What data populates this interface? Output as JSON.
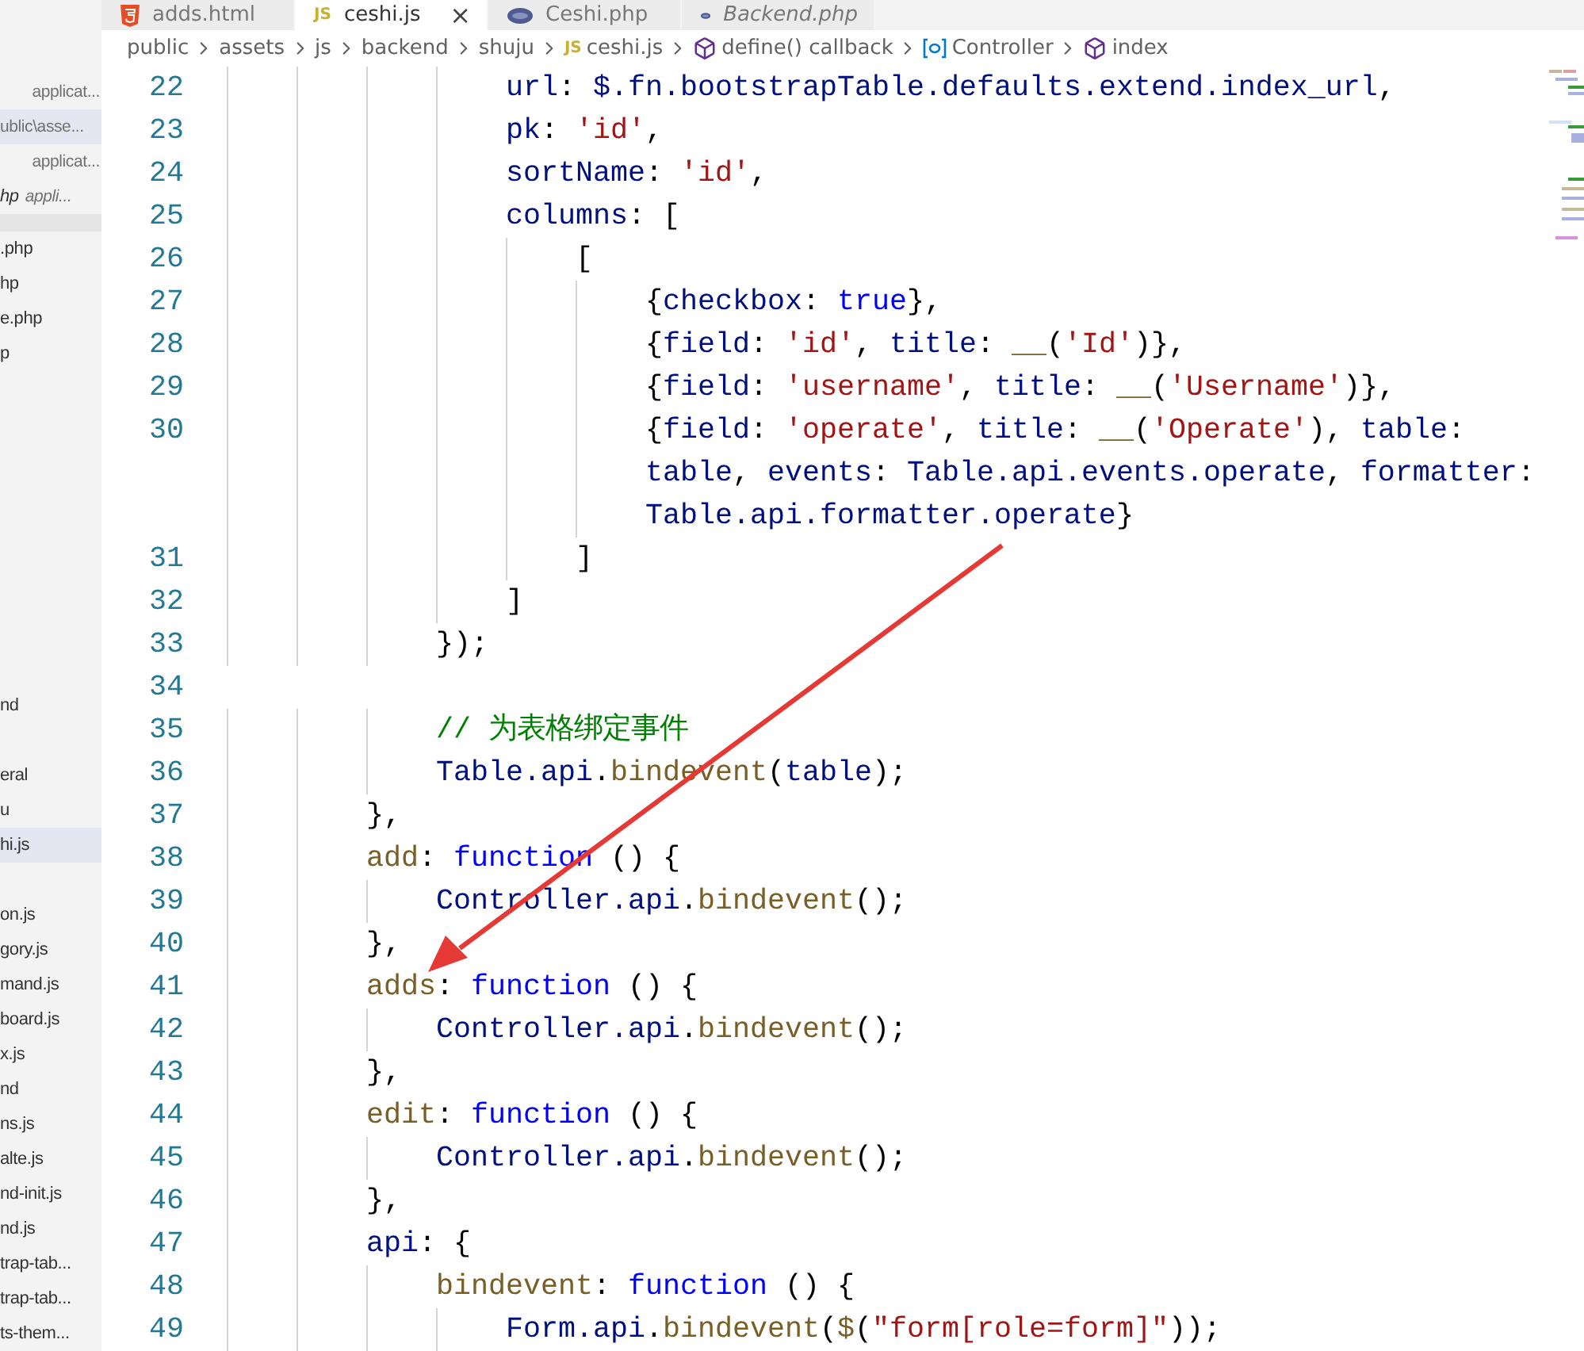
{
  "tabs": [
    {
      "label": "adds.html",
      "kind": "html",
      "selected": false,
      "preview": false
    },
    {
      "label": "ceshi.js",
      "kind": "js",
      "badge": "JS",
      "selected": true,
      "preview": false,
      "close": "×"
    },
    {
      "label": "Ceshi.php",
      "kind": "php",
      "selected": false,
      "preview": false
    },
    {
      "label": "Backend.php",
      "kind": "php",
      "selected": false,
      "preview": true
    }
  ],
  "breadcrumb": [
    {
      "label": "public",
      "kind": "folder"
    },
    {
      "label": "assets",
      "kind": "folder"
    },
    {
      "label": "js",
      "kind": "folder"
    },
    {
      "label": "backend",
      "kind": "folder"
    },
    {
      "label": "shuju",
      "kind": "folder"
    },
    {
      "label": "ceshi.js",
      "kind": "js",
      "badge": "JS"
    },
    {
      "label": "define() callback",
      "kind": "method"
    },
    {
      "label": "Controller",
      "kind": "variable"
    },
    {
      "label": "index",
      "kind": "method"
    }
  ],
  "sidebar": {
    "open_editors": [
      {
        "description": "applicat...",
        "selected": false,
        "preview": false
      },
      {
        "description": "ublic\\asse...",
        "selected": true,
        "preview": false
      },
      {
        "description": "applicat...",
        "selected": false,
        "preview": false
      },
      {
        "name": "hp",
        "description": "appli...",
        "selected": false,
        "preview": true
      }
    ],
    "files_top": [
      {
        "label": ".php",
        "selected": false
      },
      {
        "label": "hp",
        "selected": false
      },
      {
        "label": "e.php",
        "selected": false
      },
      {
        "label": "p",
        "selected": false
      }
    ],
    "file_groups": [
      [
        {
          "label": "nd",
          "selected": false
        }
      ],
      [
        {
          "label": "eral",
          "selected": false
        },
        {
          "label": "u",
          "selected": false
        },
        {
          "label": "hi.js",
          "selected": true
        }
      ],
      [
        {
          "label": "on.js",
          "selected": false
        },
        {
          "label": "gory.js",
          "selected": false
        },
        {
          "label": "mand.js",
          "selected": false
        },
        {
          "label": "board.js",
          "selected": false
        },
        {
          "label": "x.js",
          "selected": false
        },
        {
          "label": "nd",
          "selected": false
        },
        {
          "label": "ns.js",
          "selected": false
        },
        {
          "label": "alte.js",
          "selected": false
        },
        {
          "label": "nd-init.js",
          "selected": false
        },
        {
          "label": "nd.js",
          "selected": false
        },
        {
          "label": "trap-tab...",
          "selected": false
        },
        {
          "label": "trap-tab...",
          "selected": false
        },
        {
          "label": "ts-them...",
          "selected": false
        }
      ]
    ]
  },
  "code": [
    {
      "number": "22",
      "tokens": [
        {
          "kind": "key",
          "text": "                url"
        },
        {
          "kind": "p",
          "text": ": "
        },
        {
          "kind": "var",
          "text": "$.fn.bootstrapTable.defaults.extend.index_url"
        },
        {
          "kind": "p",
          "text": ","
        }
      ]
    },
    {
      "number": "23",
      "tokens": [
        {
          "kind": "key",
          "text": "                pk"
        },
        {
          "kind": "p",
          "text": ": "
        },
        {
          "kind": "str",
          "text": "'id'"
        },
        {
          "kind": "p",
          "text": ","
        }
      ]
    },
    {
      "number": "24",
      "tokens": [
        {
          "kind": "key",
          "text": "                sortName"
        },
        {
          "kind": "p",
          "text": ": "
        },
        {
          "kind": "str",
          "text": "'id'"
        },
        {
          "kind": "p",
          "text": ","
        }
      ]
    },
    {
      "number": "25",
      "tokens": [
        {
          "kind": "key",
          "text": "                columns"
        },
        {
          "kind": "p",
          "text": ": ["
        }
      ]
    },
    {
      "number": "26",
      "tokens": [
        {
          "kind": "p",
          "text": "                    ["
        }
      ]
    },
    {
      "number": "27",
      "tokens": [
        {
          "kind": "p",
          "text": "                        {"
        },
        {
          "kind": "key",
          "text": "checkbox"
        },
        {
          "kind": "p",
          "text": ": "
        },
        {
          "kind": "kw",
          "text": "true"
        },
        {
          "kind": "p",
          "text": "},"
        }
      ]
    },
    {
      "number": "28",
      "tokens": [
        {
          "kind": "p",
          "text": "                        {"
        },
        {
          "kind": "key",
          "text": "field"
        },
        {
          "kind": "p",
          "text": ": "
        },
        {
          "kind": "str",
          "text": "'id'"
        },
        {
          "kind": "p",
          "text": ", "
        },
        {
          "kind": "key",
          "text": "title"
        },
        {
          "kind": "p",
          "text": ": "
        },
        {
          "kind": "fn",
          "text": "__"
        },
        {
          "kind": "p",
          "text": "("
        },
        {
          "kind": "str",
          "text": "'Id'"
        },
        {
          "kind": "p",
          "text": ")},"
        }
      ]
    },
    {
      "number": "29",
      "tokens": [
        {
          "kind": "p",
          "text": "                        {"
        },
        {
          "kind": "key",
          "text": "field"
        },
        {
          "kind": "p",
          "text": ": "
        },
        {
          "kind": "str",
          "text": "'username'"
        },
        {
          "kind": "p",
          "text": ", "
        },
        {
          "kind": "key",
          "text": "title"
        },
        {
          "kind": "p",
          "text": ": "
        },
        {
          "kind": "fn",
          "text": "__"
        },
        {
          "kind": "p",
          "text": "("
        },
        {
          "kind": "str",
          "text": "'Username'"
        },
        {
          "kind": "p",
          "text": ")},"
        }
      ]
    },
    {
      "number": "30",
      "tokens": [
        {
          "kind": "p",
          "text": "                        {"
        },
        {
          "kind": "key",
          "text": "field"
        },
        {
          "kind": "p",
          "text": ": "
        },
        {
          "kind": "str",
          "text": "'operate'"
        },
        {
          "kind": "p",
          "text": ", "
        },
        {
          "kind": "key",
          "text": "title"
        },
        {
          "kind": "p",
          "text": ": "
        },
        {
          "kind": "fn",
          "text": "__"
        },
        {
          "kind": "p",
          "text": "("
        },
        {
          "kind": "str",
          "text": "'Operate'"
        },
        {
          "kind": "p",
          "text": "), "
        },
        {
          "kind": "key",
          "text": "table"
        },
        {
          "kind": "p",
          "text": ":"
        }
      ]
    },
    {
      "tokens": [
        {
          "kind": "var",
          "text": "                        table"
        },
        {
          "kind": "p",
          "text": ", "
        },
        {
          "kind": "key",
          "text": "events"
        },
        {
          "kind": "p",
          "text": ": "
        },
        {
          "kind": "var",
          "text": "Table.api.events.operate"
        },
        {
          "kind": "p",
          "text": ", "
        },
        {
          "kind": "key",
          "text": "formatter"
        },
        {
          "kind": "p",
          "text": ":"
        }
      ]
    },
    {
      "tokens": [
        {
          "kind": "var",
          "text": "                        Table.api.formatter.operate"
        },
        {
          "kind": "p",
          "text": "}"
        }
      ]
    },
    {
      "number": "31",
      "tokens": [
        {
          "kind": "p",
          "text": "                    ]"
        }
      ]
    },
    {
      "number": "32",
      "tokens": [
        {
          "kind": "p",
          "text": "                ]"
        }
      ]
    },
    {
      "number": "33",
      "tokens": [
        {
          "kind": "p",
          "text": "            });"
        }
      ]
    },
    {
      "number": "34"
    },
    {
      "number": "35",
      "tokens": [
        {
          "kind": "comment",
          "text": "            // 为表格绑定事件"
        }
      ]
    },
    {
      "number": "36",
      "tokens": [
        {
          "kind": "var",
          "text": "            Table.api"
        },
        {
          "kind": "p",
          "text": "."
        },
        {
          "kind": "fn",
          "text": "bindevent"
        },
        {
          "kind": "p",
          "text": "("
        },
        {
          "kind": "var",
          "text": "table"
        },
        {
          "kind": "p",
          "text": ");"
        }
      ]
    },
    {
      "number": "37",
      "tokens": [
        {
          "kind": "p",
          "text": "        },"
        }
      ]
    },
    {
      "number": "38",
      "tokens": [
        {
          "kind": "fn",
          "text": "        add"
        },
        {
          "kind": "p",
          "text": ": "
        },
        {
          "kind": "kw",
          "text": "function"
        },
        {
          "kind": "p",
          "text": " () {"
        }
      ]
    },
    {
      "number": "39",
      "tokens": [
        {
          "kind": "var",
          "text": "            Controller.api"
        },
        {
          "kind": "p",
          "text": "."
        },
        {
          "kind": "fn",
          "text": "bindevent"
        },
        {
          "kind": "p",
          "text": "();"
        }
      ]
    },
    {
      "number": "40",
      "tokens": [
        {
          "kind": "p",
          "text": "        },"
        }
      ]
    },
    {
      "number": "41",
      "tokens": [
        {
          "kind": "fn",
          "text": "        adds"
        },
        {
          "kind": "p",
          "text": ": "
        },
        {
          "kind": "kw",
          "text": "function"
        },
        {
          "kind": "p",
          "text": " () {"
        }
      ]
    },
    {
      "number": "42",
      "tokens": [
        {
          "kind": "var",
          "text": "            Controller.api"
        },
        {
          "kind": "p",
          "text": "."
        },
        {
          "kind": "fn",
          "text": "bindevent"
        },
        {
          "kind": "p",
          "text": "();"
        }
      ]
    },
    {
      "number": "43",
      "tokens": [
        {
          "kind": "p",
          "text": "        },"
        }
      ]
    },
    {
      "number": "44",
      "tokens": [
        {
          "kind": "fn",
          "text": "        edit"
        },
        {
          "kind": "p",
          "text": ": "
        },
        {
          "kind": "kw",
          "text": "function"
        },
        {
          "kind": "p",
          "text": " () {"
        }
      ]
    },
    {
      "number": "45",
      "tokens": [
        {
          "kind": "var",
          "text": "            Controller.api"
        },
        {
          "kind": "p",
          "text": "."
        },
        {
          "kind": "fn",
          "text": "bindevent"
        },
        {
          "kind": "p",
          "text": "();"
        }
      ]
    },
    {
      "number": "46",
      "tokens": [
        {
          "kind": "p",
          "text": "        },"
        }
      ]
    },
    {
      "number": "47",
      "tokens": [
        {
          "kind": "key",
          "text": "        api"
        },
        {
          "kind": "p",
          "text": ": {"
        }
      ]
    },
    {
      "number": "48",
      "tokens": [
        {
          "kind": "fn",
          "text": "            bindevent"
        },
        {
          "kind": "p",
          "text": ": "
        },
        {
          "kind": "kw",
          "text": "function"
        },
        {
          "kind": "p",
          "text": " () {"
        }
      ]
    },
    {
      "number": "49",
      "tokens": [
        {
          "kind": "var",
          "text": "                Form.api"
        },
        {
          "kind": "p",
          "text": "."
        },
        {
          "kind": "fn",
          "text": "bindevent"
        },
        {
          "kind": "p",
          "text": "("
        },
        {
          "kind": "fn",
          "text": "$"
        },
        {
          "kind": "p",
          "text": "("
        },
        {
          "kind": "str",
          "text": "\"form[role=form]\""
        },
        {
          "kind": "p",
          "text": "));"
        }
      ]
    }
  ]
}
